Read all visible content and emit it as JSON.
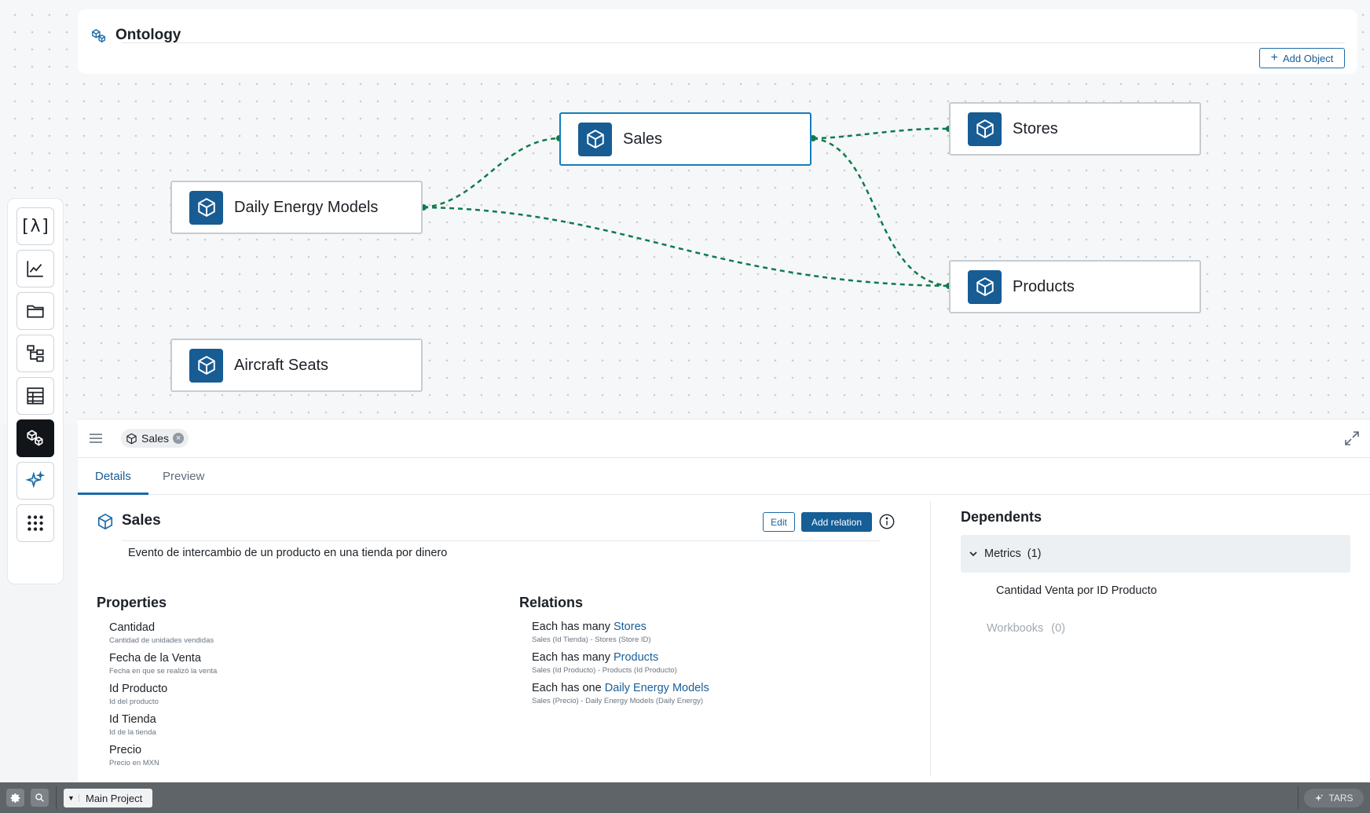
{
  "header": {
    "title": "Ontology",
    "add_object_label": "Add Object"
  },
  "rail": {
    "items": [
      {
        "icon": "lambda-icon"
      },
      {
        "icon": "line-chart-icon"
      },
      {
        "icon": "folder-icon"
      },
      {
        "icon": "hierarchy-icon"
      },
      {
        "icon": "table-icon"
      },
      {
        "icon": "cubes-icon",
        "active": true
      },
      {
        "icon": "sparkle-icon"
      },
      {
        "icon": "apps-grid-icon"
      }
    ]
  },
  "graph": {
    "nodes": [
      {
        "label": "Sales",
        "selected": true
      },
      {
        "label": "Stores"
      },
      {
        "label": "Daily Energy Models"
      },
      {
        "label": "Products"
      },
      {
        "label": "Aircraft Seats"
      }
    ],
    "edge_color": "#0e7a4d"
  },
  "panel": {
    "tag_label": "Sales",
    "tabs": [
      "Details",
      "Preview"
    ],
    "active_tab": "Details",
    "object": {
      "title": "Sales",
      "edit_label": "Edit",
      "add_relation_label": "Add relation",
      "description": "Evento de intercambio de un producto en una tienda por dinero"
    },
    "properties_title": "Properties",
    "properties": [
      {
        "name": "Cantidad",
        "desc": "Cantidad de unidades vendidas"
      },
      {
        "name": "Fecha de la Venta",
        "desc": "Fecha en que se realizó la venta"
      },
      {
        "name": "Id Producto",
        "desc": "Id del producto"
      },
      {
        "name": "Id Tienda",
        "desc": "Id de la tienda"
      },
      {
        "name": "Precio",
        "desc": "Precio en MXN"
      }
    ],
    "relations_title": "Relations",
    "relations": [
      {
        "prefix": "Each has many",
        "target": "Stores",
        "sub": "Sales (Id Tienda) - Stores (Store ID)"
      },
      {
        "prefix": "Each has many",
        "target": "Products",
        "sub": "Sales (Id Producto) - Products (Id Producto)"
      },
      {
        "prefix": "Each has one",
        "target": "Daily Energy Models",
        "sub": "Sales (Precio) - Daily Energy Models (Daily Energy)"
      }
    ],
    "dependents": {
      "title": "Dependents",
      "metrics_label": "Metrics",
      "metrics_count": "(1)",
      "metric_items": [
        "Cantidad Venta por ID Producto"
      ],
      "workbooks_label": "Workbooks",
      "workbooks_count": "(0)"
    }
  },
  "bottombar": {
    "project_label": "Main Project",
    "tars_label": "TARS"
  },
  "colors": {
    "accent": "#1a5e96",
    "node_icon_bg": "#185c94",
    "active_rail": "#111418"
  }
}
